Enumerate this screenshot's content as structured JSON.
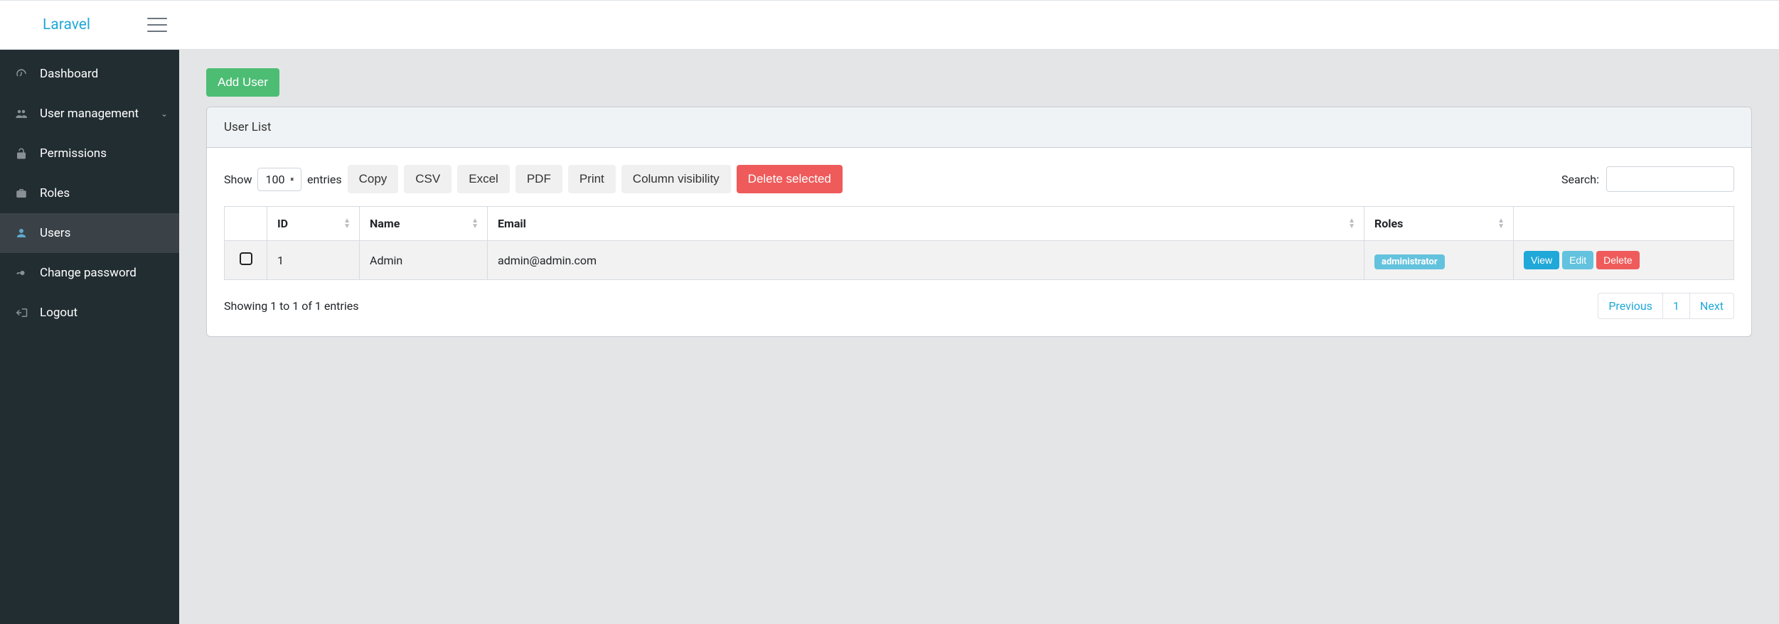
{
  "navbar": {
    "brand": "Laravel"
  },
  "sidebar": {
    "items": [
      {
        "label": "Dashboard",
        "icon": "speedometer-icon",
        "active": false,
        "accent": false,
        "chevron": false
      },
      {
        "label": "User management",
        "icon": "users-icon",
        "active": false,
        "accent": false,
        "chevron": true
      },
      {
        "label": "Permissions",
        "icon": "unlock-icon",
        "active": false,
        "accent": false,
        "chevron": false
      },
      {
        "label": "Roles",
        "icon": "briefcase-icon",
        "active": false,
        "accent": false,
        "chevron": false
      },
      {
        "label": "Users",
        "icon": "user-icon",
        "active": true,
        "accent": true,
        "chevron": false
      },
      {
        "label": "Change password",
        "icon": "key-icon",
        "active": false,
        "accent": false,
        "chevron": false
      },
      {
        "label": "Logout",
        "icon": "signout-icon",
        "active": false,
        "accent": false,
        "chevron": false
      }
    ]
  },
  "page": {
    "add_user_label": "Add User",
    "card_title": "User List"
  },
  "toolbar": {
    "show_label": "Show",
    "entries_label": "entries",
    "length_value": "100",
    "buttons": {
      "copy": "Copy",
      "csv": "CSV",
      "excel": "Excel",
      "pdf": "PDF",
      "print": "Print",
      "colvis": "Column visibility",
      "delete_selected": "Delete selected"
    },
    "search_label": "Search:",
    "search_value": ""
  },
  "table": {
    "headers": {
      "id": "ID",
      "name": "Name",
      "email": "Email",
      "roles": "Roles"
    },
    "rows": [
      {
        "id": "1",
        "name": "Admin",
        "email": "admin@admin.com",
        "role_badge": "administrator"
      }
    ],
    "actions": {
      "view": "View",
      "edit": "Edit",
      "delete": "Delete"
    },
    "info": "Showing 1 to 1 of 1 entries",
    "pager": {
      "prev": "Previous",
      "page": "1",
      "next": "Next"
    }
  }
}
